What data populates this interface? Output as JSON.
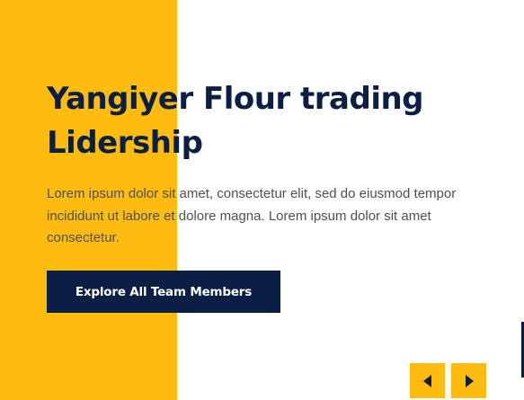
{
  "hero": {
    "title_line1": "Yangiyer Flour trading",
    "title_line2": "Lidership",
    "description": "Lorem ipsum dolor sit amet, consectetur elit, sed do eiusmod tempor incididunt ut labore et dolore magna. Lorem ipsum dolor sit amet consectetur.",
    "cta_label": "Explore All Team Members"
  },
  "slider": {
    "prev_icon": "caret-left-icon",
    "next_icon": "caret-right-icon"
  },
  "colors": {
    "accent_yellow": "#FEBC11",
    "navy": "#0B1F44",
    "body_text": "#4F4F4F",
    "background": "#FFFFFF"
  }
}
